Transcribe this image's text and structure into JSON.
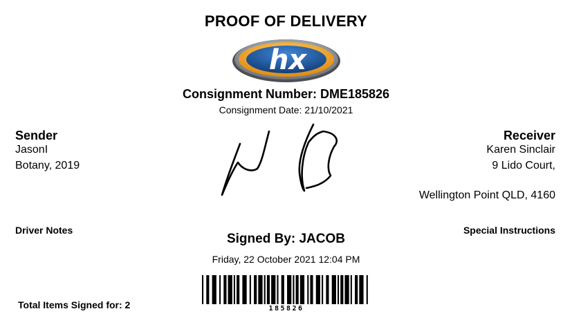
{
  "document": {
    "title": "PROOF OF DELIVERY",
    "logo_text": "hx",
    "consignment_number": "Consignment Number: DME185826",
    "consignment_date": "Consignment Date: 21/10/2021"
  },
  "sender": {
    "heading": "Sender",
    "lines": [
      "JasonI",
      "Botany, 2019"
    ]
  },
  "receiver": {
    "heading": "Receiver",
    "lines": [
      "Karen Sinclair",
      "9 Lido Court,",
      "",
      "Wellington Point QLD, 4160"
    ]
  },
  "driver_notes": {
    "label": "Driver Notes"
  },
  "special_instructions": {
    "label": "Special Instructions"
  },
  "signature": {
    "signed_by": "Signed By: JACOB",
    "signed_date": "Friday, 22 October 2021 12:04 PM"
  },
  "barcode": {
    "number": "185826"
  },
  "totals": {
    "label": "Total Items Signed for: 2"
  },
  "colors": {
    "logo_blue": "#1f5ea8",
    "logo_orange": "#f5a51e",
    "logo_ring": "#b0b4b8",
    "ink": "#000000"
  }
}
